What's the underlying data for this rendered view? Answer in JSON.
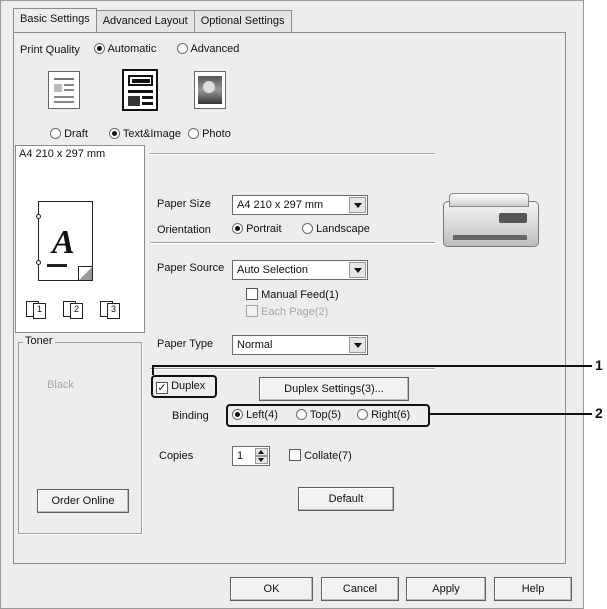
{
  "tabs": [
    {
      "label": "Basic Settings",
      "active": true
    },
    {
      "label": "Advanced Layout",
      "active": false
    },
    {
      "label": "Optional Settings",
      "active": false
    }
  ],
  "print_quality": {
    "label": "Print Quality",
    "options": [
      {
        "label": "Automatic",
        "selected": true
      },
      {
        "label": "Advanced",
        "selected": false
      }
    ],
    "modes": [
      {
        "label": "Draft",
        "selected": false
      },
      {
        "label": "Text&Image",
        "selected": true
      },
      {
        "label": "Photo",
        "selected": false
      }
    ]
  },
  "preview": {
    "header": "A4 210 x 297 mm",
    "letter": "A"
  },
  "toner": {
    "legend": "Toner",
    "color_label": "Black",
    "order_button": "Order Online"
  },
  "paper": {
    "size_label": "Paper Size",
    "size_value": "A4 210 x 297 mm",
    "orientation_label": "Orientation",
    "orientation_options": [
      {
        "label": "Portrait",
        "selected": true
      },
      {
        "label": "Landscape",
        "selected": false
      }
    ],
    "source_label": "Paper Source",
    "source_value": "Auto Selection",
    "manual_feed": "Manual Feed(1)",
    "each_page": "Each Page(2)",
    "type_label": "Paper Type",
    "type_value": "Normal"
  },
  "duplex": {
    "checkbox_label": "Duplex",
    "checked": true,
    "settings_button": "Duplex Settings(3)...",
    "binding_label": "Binding",
    "binding_options": [
      {
        "label": "Left(4)",
        "selected": true
      },
      {
        "label": "Top(5)",
        "selected": false
      },
      {
        "label": "Right(6)",
        "selected": false
      }
    ]
  },
  "copies": {
    "label": "Copies",
    "value": "1",
    "collate_label": "Collate(7)"
  },
  "default_button": "Default",
  "footer": {
    "ok": "OK",
    "cancel": "Cancel",
    "apply": "Apply",
    "help": "Help"
  },
  "callouts": [
    "1",
    "2"
  ]
}
